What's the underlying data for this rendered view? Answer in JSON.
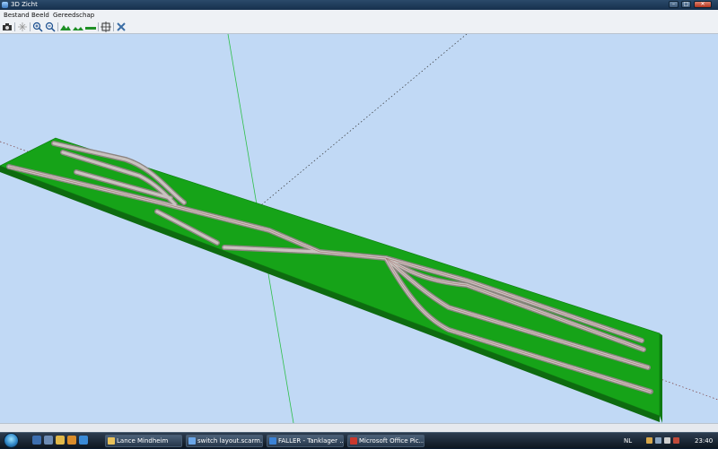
{
  "window": {
    "title": "3D Zicht",
    "minimize_glyph": "–",
    "maximize_glyph": "□",
    "close_glyph": "✕"
  },
  "menu": {
    "items": [
      "Bestand",
      "Beeld",
      "Gereedschap"
    ]
  },
  "toolbar": {
    "icons": [
      "camera-icon",
      "move-icon",
      "zoom-in-icon",
      "zoom-out-icon",
      "landscape-icon",
      "landscape-flat-icon",
      "baseboard-icon",
      "center-view-icon",
      "tools-icon"
    ]
  },
  "taskbar": {
    "items": [
      {
        "label": "Lance Mindheim",
        "icon_color": "#e8c15a"
      },
      {
        "label": "switch layout.scarm...",
        "icon_color": "#6aa6e8"
      },
      {
        "label": "FALLER - Tanklager ...",
        "icon_color": "#3b82d6"
      },
      {
        "label": "Microsoft Office Pic...",
        "icon_color": "#c9382d"
      }
    ],
    "tray": {
      "language": "NL",
      "clock": "23:40"
    }
  },
  "colors": {
    "baseboard": "#16a318",
    "sky": "#c1d9f5",
    "track": "#b6aeaa"
  }
}
